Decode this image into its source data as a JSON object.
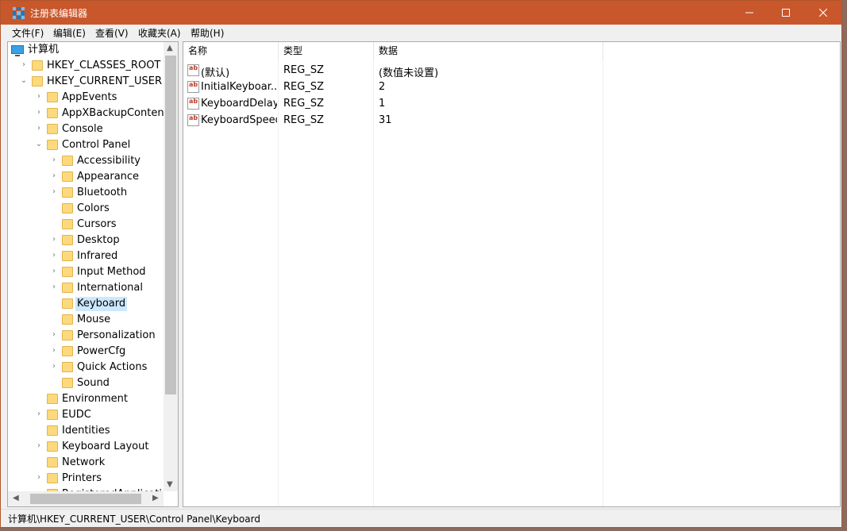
{
  "window": {
    "title": "注册表编辑器"
  },
  "menu": [
    "文件(F)",
    "编辑(E)",
    "查看(V)",
    "收藏夹(A)",
    "帮助(H)"
  ],
  "tree": {
    "root": "计算机",
    "items": [
      {
        "label": "HKEY_CLASSES_ROOT",
        "level": 1,
        "expandable": true,
        "expanded": false
      },
      {
        "label": "HKEY_CURRENT_USER",
        "level": 1,
        "expandable": true,
        "expanded": true
      },
      {
        "label": "AppEvents",
        "level": 2,
        "expandable": true,
        "expanded": false
      },
      {
        "label": "AppXBackupContentTy",
        "level": 2,
        "expandable": true,
        "expanded": false
      },
      {
        "label": "Console",
        "level": 2,
        "expandable": true,
        "expanded": false
      },
      {
        "label": "Control Panel",
        "level": 2,
        "expandable": true,
        "expanded": true
      },
      {
        "label": "Accessibility",
        "level": 3,
        "expandable": true,
        "expanded": false
      },
      {
        "label": "Appearance",
        "level": 3,
        "expandable": true,
        "expanded": false
      },
      {
        "label": "Bluetooth",
        "level": 3,
        "expandable": true,
        "expanded": false
      },
      {
        "label": "Colors",
        "level": 3,
        "expandable": false,
        "expanded": false
      },
      {
        "label": "Cursors",
        "level": 3,
        "expandable": false,
        "expanded": false
      },
      {
        "label": "Desktop",
        "level": 3,
        "expandable": true,
        "expanded": false
      },
      {
        "label": "Infrared",
        "level": 3,
        "expandable": true,
        "expanded": false
      },
      {
        "label": "Input Method",
        "level": 3,
        "expandable": true,
        "expanded": false
      },
      {
        "label": "International",
        "level": 3,
        "expandable": true,
        "expanded": false
      },
      {
        "label": "Keyboard",
        "level": 3,
        "expandable": false,
        "expanded": false,
        "selected": true
      },
      {
        "label": "Mouse",
        "level": 3,
        "expandable": false,
        "expanded": false
      },
      {
        "label": "Personalization",
        "level": 3,
        "expandable": true,
        "expanded": false
      },
      {
        "label": "PowerCfg",
        "level": 3,
        "expandable": true,
        "expanded": false
      },
      {
        "label": "Quick Actions",
        "level": 3,
        "expandable": true,
        "expanded": false
      },
      {
        "label": "Sound",
        "level": 3,
        "expandable": false,
        "expanded": false
      },
      {
        "label": "Environment",
        "level": 2,
        "expandable": false,
        "expanded": false
      },
      {
        "label": "EUDC",
        "level": 2,
        "expandable": true,
        "expanded": false
      },
      {
        "label": "Identities",
        "level": 2,
        "expandable": false,
        "expanded": false
      },
      {
        "label": "Keyboard Layout",
        "level": 2,
        "expandable": true,
        "expanded": false
      },
      {
        "label": "Network",
        "level": 2,
        "expandable": false,
        "expanded": false
      },
      {
        "label": "Printers",
        "level": 2,
        "expandable": true,
        "expanded": false
      },
      {
        "label": "RegisteredApplications",
        "level": 2,
        "expandable": false,
        "expanded": false
      }
    ]
  },
  "list": {
    "columns": [
      "名称",
      "类型",
      "数据"
    ],
    "rows": [
      {
        "name": "(默认)",
        "type": "REG_SZ",
        "data": "(数值未设置)"
      },
      {
        "name": "InitialKeyboar...",
        "type": "REG_SZ",
        "data": "2"
      },
      {
        "name": "KeyboardDelay",
        "type": "REG_SZ",
        "data": "1"
      },
      {
        "name": "KeyboardSpeed",
        "type": "REG_SZ",
        "data": "31"
      }
    ]
  },
  "status": {
    "path": "计算机\\HKEY_CURRENT_USER\\Control Panel\\Keyboard"
  },
  "colors": {
    "titlebar": "#c9572c",
    "selection": "#cce8ff",
    "folder": "#fcd97c"
  }
}
